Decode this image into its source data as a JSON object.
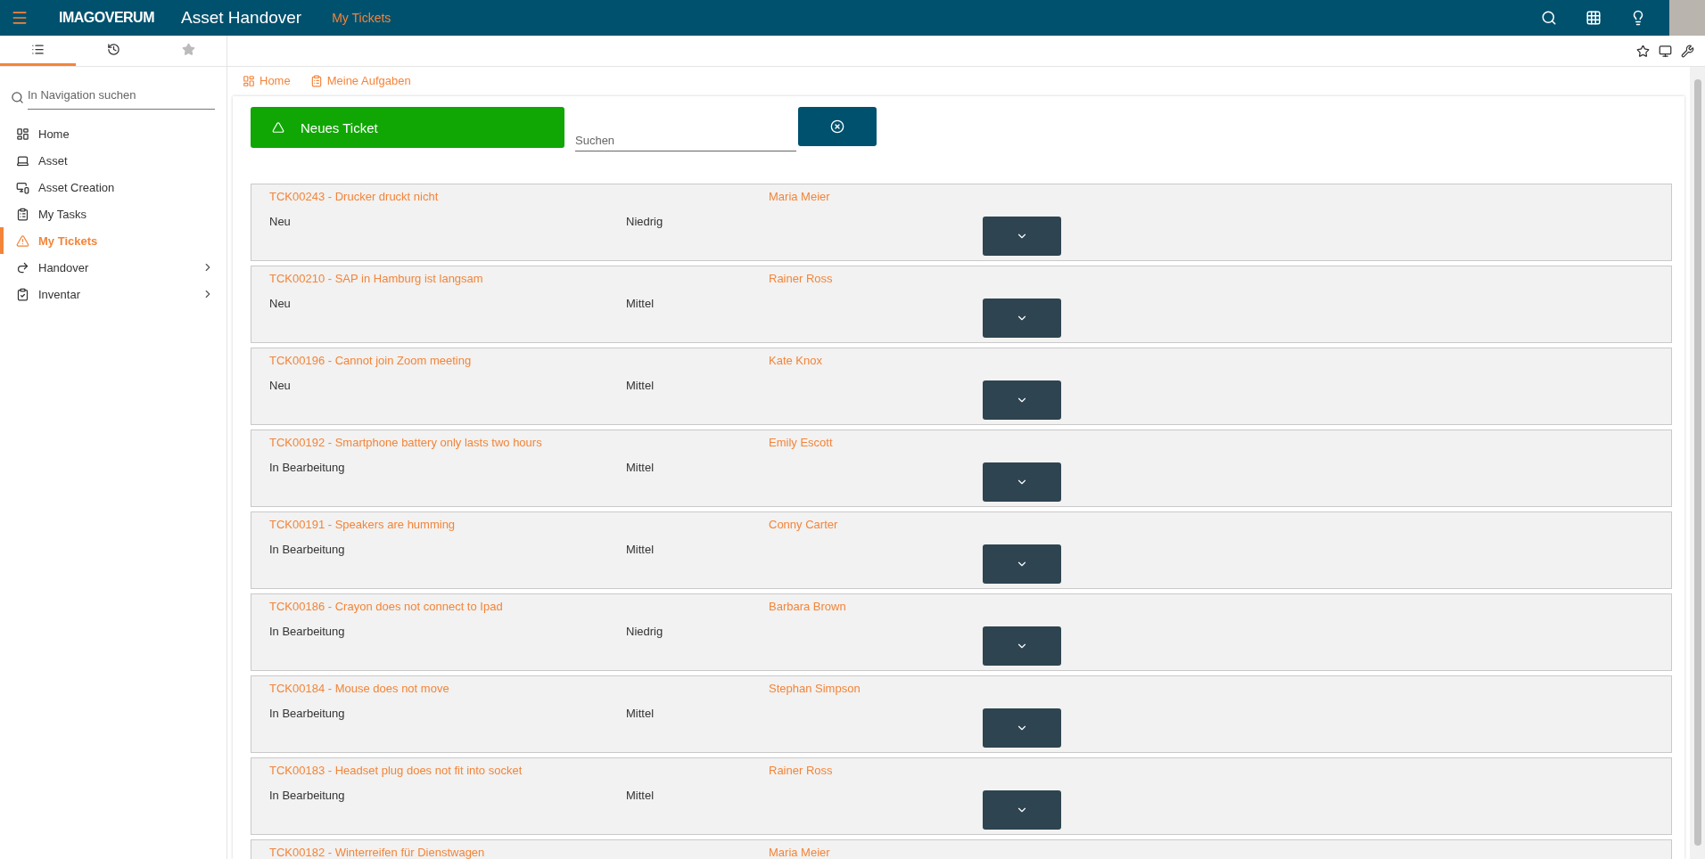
{
  "header": {
    "logo": "IMAGOVERUM",
    "app_title": "Asset Handover",
    "page": "My Tickets"
  },
  "sidebar": {
    "tabs": [
      {
        "kind": "list",
        "selected": true
      },
      {
        "kind": "history",
        "selected": false
      },
      {
        "kind": "favorites",
        "selected": false
      }
    ],
    "search": {
      "placeholder": "In Navigation suchen"
    },
    "items": [
      {
        "kind": "home",
        "label": "Home",
        "selected": false,
        "expandable": false
      },
      {
        "kind": "asset",
        "label": "Asset",
        "selected": false,
        "expandable": false
      },
      {
        "kind": "creation",
        "label": "Asset Creation",
        "selected": false,
        "expandable": false
      },
      {
        "kind": "tasks",
        "label": "My Tasks",
        "selected": false,
        "expandable": false
      },
      {
        "kind": "tickets",
        "label": "My Tickets",
        "selected": true,
        "expandable": false
      },
      {
        "kind": "handover",
        "label": "Handover",
        "selected": false,
        "expandable": true
      },
      {
        "kind": "inventory",
        "label": "Inventar",
        "selected": false,
        "expandable": true
      }
    ]
  },
  "breadcrumbs": [
    {
      "kind": "home",
      "label": "Home"
    },
    {
      "kind": "tasks",
      "label": "Meine Aufgaben"
    }
  ],
  "toolbar": {
    "new_button": "Neues Ticket",
    "search": {
      "placeholder": "Suchen"
    }
  },
  "tickets": [
    {
      "title": "TCK00243 - Drucker druckt nicht",
      "person": "Maria Meier",
      "status": "Neu",
      "priority": "Niedrig"
    },
    {
      "title": "TCK00210 - SAP in Hamburg ist langsam",
      "person": "Rainer Ross",
      "status": "Neu",
      "priority": "Mittel"
    },
    {
      "title": "TCK00196 - Cannot join Zoom meeting",
      "person": "Kate Knox",
      "status": "Neu",
      "priority": "Mittel"
    },
    {
      "title": "TCK00192 - Smartphone battery only lasts two hours",
      "person": "Emily Escott",
      "status": "In Bearbeitung",
      "priority": "Mittel"
    },
    {
      "title": "TCK00191 - Speakers are humming",
      "person": "Conny Carter",
      "status": "In Bearbeitung",
      "priority": "Mittel"
    },
    {
      "title": "TCK00186 - Crayon does not connect to Ipad",
      "person": "Barbara Brown",
      "status": "In Bearbeitung",
      "priority": "Niedrig"
    },
    {
      "title": "TCK00184 - Mouse does not move",
      "person": "Stephan Simpson",
      "status": "In Bearbeitung",
      "priority": "Mittel"
    },
    {
      "title": "TCK00183 - Headset plug does not fit into socket",
      "person": "Rainer Ross",
      "status": "In Bearbeitung",
      "priority": "Mittel"
    },
    {
      "title": "TCK00182 - Winterreifen für Dienstwagen",
      "person": "Maria Meier"
    }
  ]
}
